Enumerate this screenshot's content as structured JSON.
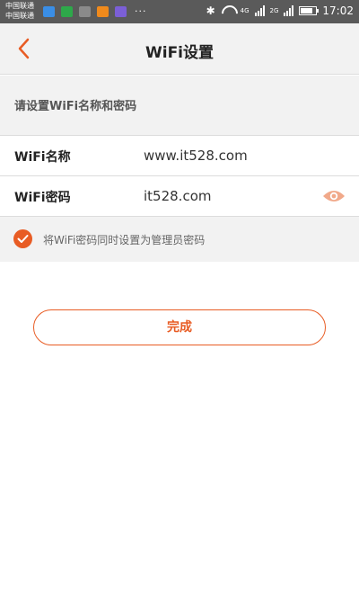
{
  "status_bar": {
    "carrier_line1": "中国联通",
    "carrier_line2": "中国联通",
    "more_dots": "···",
    "net_4g": "4G",
    "net_2g": "2G",
    "time": "17:02",
    "app_colors": [
      "#3a8ee6",
      "#2ea84a",
      "#8a8a8a",
      "#f08a1c",
      "#7b5fd6"
    ]
  },
  "nav": {
    "title": "WiFi设置",
    "back_icon": "chevron-left-icon"
  },
  "section": {
    "header": "请设置WiFi名称和密码"
  },
  "form": {
    "name_label": "WiFi名称",
    "name_value": "www.it528.com",
    "password_label": "WiFi密码",
    "password_value": "it528.com",
    "toggle_visibility_icon": "eye-icon"
  },
  "option": {
    "checked": true,
    "label": "将WiFi密码同时设置为管理员密码"
  },
  "actions": {
    "done_label": "完成"
  },
  "colors": {
    "accent": "#e85c24",
    "background": "#f2f2f2",
    "divider": "#dcdcdc"
  }
}
